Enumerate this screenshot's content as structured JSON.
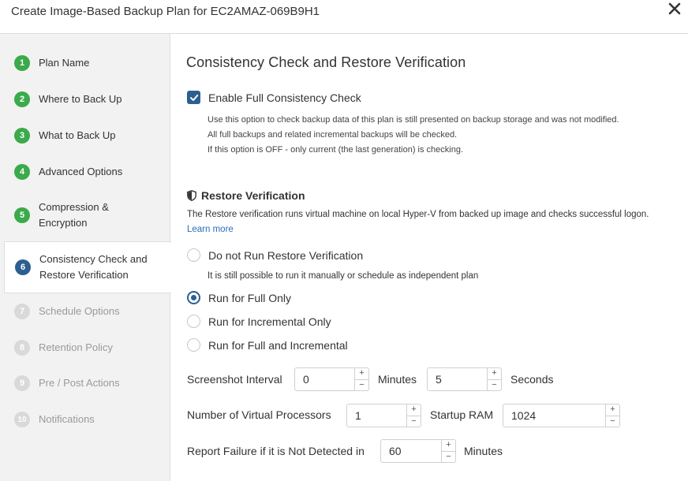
{
  "window": {
    "title": "Create Image-Based Backup Plan for EC2AMAZ-069B9H1"
  },
  "steps": [
    {
      "num": "1",
      "label": "Plan Name",
      "state": "done"
    },
    {
      "num": "2",
      "label": "Where to Back Up",
      "state": "done"
    },
    {
      "num": "3",
      "label": "What to Back Up",
      "state": "done"
    },
    {
      "num": "4",
      "label": "Advanced Options",
      "state": "done"
    },
    {
      "num": "5",
      "label": "Compression & Encryption",
      "state": "done"
    },
    {
      "num": "6",
      "label": "Consistency Check and Restore Verification",
      "state": "active"
    },
    {
      "num": "7",
      "label": "Schedule Options",
      "state": "future"
    },
    {
      "num": "8",
      "label": "Retention Policy",
      "state": "future"
    },
    {
      "num": "9",
      "label": "Pre / Post Actions",
      "state": "future"
    },
    {
      "num": "10",
      "label": "Notifications",
      "state": "future"
    }
  ],
  "main": {
    "heading": "Consistency Check and Restore Verification",
    "consistency": {
      "checkbox_label": "Enable Full Consistency Check",
      "checked": true,
      "notes": [
        "Use this option to check backup data of this plan is still presented on backup storage and was not modified.",
        "All full backups and related incremental backups will be checked.",
        "If this option is OFF - only current (the last generation) is checking."
      ]
    },
    "restore": {
      "heading": "Restore Verification",
      "description": "The Restore verification runs virtual machine on local Hyper-V from backed up image and checks successful logon.",
      "learn_more": "Learn more",
      "options": [
        {
          "label": "Do not Run Restore Verification",
          "selected": false
        },
        {
          "label": "Run for Full Only",
          "selected": true
        },
        {
          "label": "Run for Incremental Only",
          "selected": false
        },
        {
          "label": "Run for Full and Incremental",
          "selected": false
        }
      ],
      "option_hint": "It is still possible to run it manually or schedule as independent plan"
    },
    "fields": {
      "screenshot_interval_label": "Screenshot Interval",
      "minutes_value": "0",
      "minutes_unit": "Minutes",
      "seconds_value": "5",
      "seconds_unit": "Seconds",
      "vcpu_label": "Number of Virtual Processors",
      "vcpu_value": "1",
      "ram_label": "Startup RAM",
      "ram_value": "1024",
      "report_failure_label": "Report Failure if it is Not Detected in",
      "report_failure_value": "60",
      "report_failure_unit": "Minutes"
    }
  },
  "colors": {
    "accent": "#2c5f8f",
    "done": "#3aaa4a",
    "pending": "#d9d9d9",
    "link": "#2a6ebb"
  },
  "icons": {
    "close": "close-icon",
    "shield": "shield-icon",
    "check": "checkmark-icon"
  }
}
